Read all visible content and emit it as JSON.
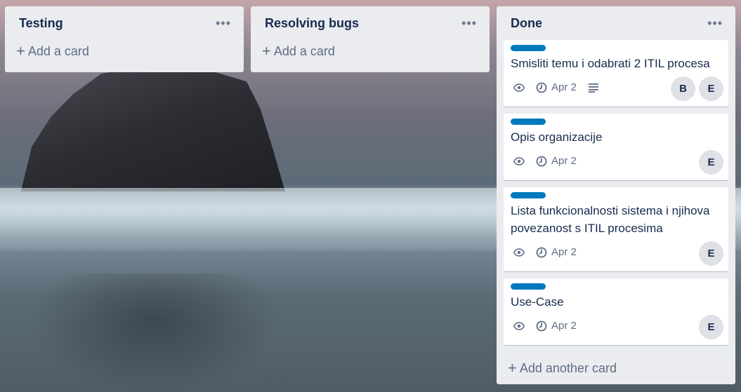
{
  "lists": [
    {
      "title": "Testing",
      "add_label": "Add a card"
    },
    {
      "title": "Resolving bugs",
      "add_label": "Add a card"
    },
    {
      "title": "Done",
      "add_label": "Add another card",
      "cards": [
        {
          "label_color": "#0079bf",
          "title": "Smisliti temu i odabrati 2 ITIL procesa",
          "due": "Apr 2",
          "has_description": true,
          "members": [
            "B",
            "E"
          ]
        },
        {
          "label_color": "#0079bf",
          "title": "Opis organizacije",
          "due": "Apr 2",
          "has_description": false,
          "members": [
            "E"
          ]
        },
        {
          "label_color": "#0079bf",
          "title": "Lista funkcionalnosti sistema i njihova povezanost s ITIL procesima",
          "due": "Apr 2",
          "has_description": false,
          "members": [
            "E"
          ]
        },
        {
          "label_color": "#0079bf",
          "title": "Use-Case",
          "due": "Apr 2",
          "has_description": false,
          "members": [
            "E"
          ]
        }
      ]
    }
  ],
  "icons": {
    "list_menu": "ellipsis-icon",
    "add": "plus-icon",
    "watch": "eye-icon",
    "due": "clock-icon",
    "description": "description-icon"
  }
}
